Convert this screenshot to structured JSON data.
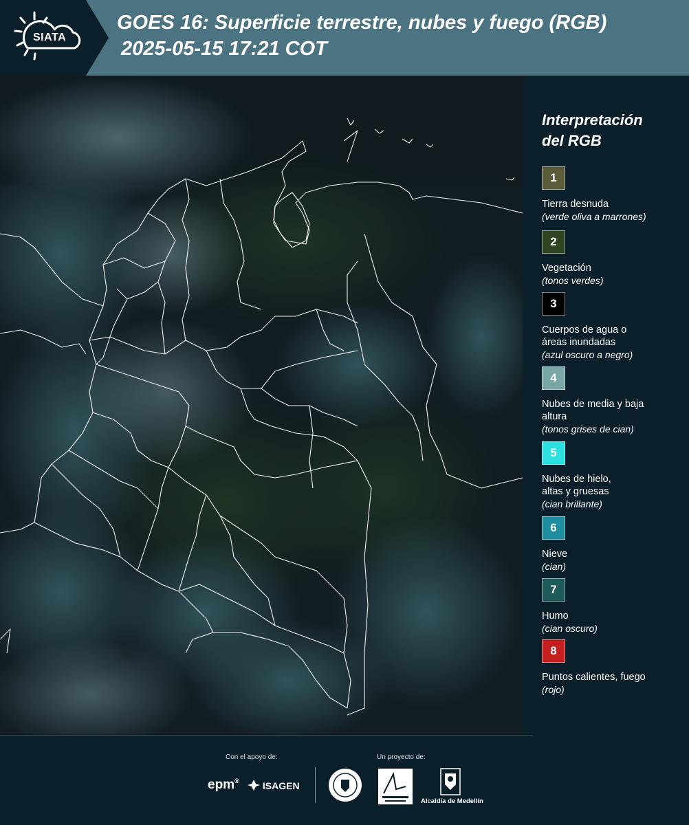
{
  "header": {
    "logo": "SIATA",
    "title_line1": "GOES 16: Superficie terrestre, nubes y fuego (RGB)",
    "title_line2": "2025-05-15 17:21 COT"
  },
  "legend": {
    "title_line1": "Interpretación",
    "title_line2": "del RGB",
    "items": [
      {
        "num": "1",
        "color": "#5a5c3a",
        "label": "Tierra desnuda",
        "sub": "(verde oliva a marrones)"
      },
      {
        "num": "2",
        "color": "#2f4420",
        "label": "Vegetación",
        "sub": "(tonos verdes)"
      },
      {
        "num": "3",
        "color": "#000000",
        "label": "Cuerpos de agua o áreas inundadas",
        "sub": "(azul oscuro a negro)"
      },
      {
        "num": "4",
        "color": "#79a7a6",
        "label": "Nubes de media y baja altura",
        "sub": "(tonos grises de cian)"
      },
      {
        "num": "5",
        "color": "#2de0e0",
        "label": "Nubes de hielo, altas y gruesas",
        "sub": "(cian brillante)"
      },
      {
        "num": "6",
        "color": "#1f8ea0",
        "label": "Nieve",
        "sub": "(cian)"
      },
      {
        "num": "7",
        "color": "#1f5a5a",
        "label": "Humo",
        "sub": "(cian oscuro)"
      },
      {
        "num": "8",
        "color": "#c41e1e",
        "label": "Puntos calientes, fuego",
        "sub": "(rojo)"
      }
    ]
  },
  "footer": {
    "support_label": "Con el apoyo de:",
    "project_label": "Un proyecto de:",
    "sponsor1": "epm",
    "sponsor2": "ISAGEN",
    "partner3": "Alcaldía de Medellín"
  }
}
